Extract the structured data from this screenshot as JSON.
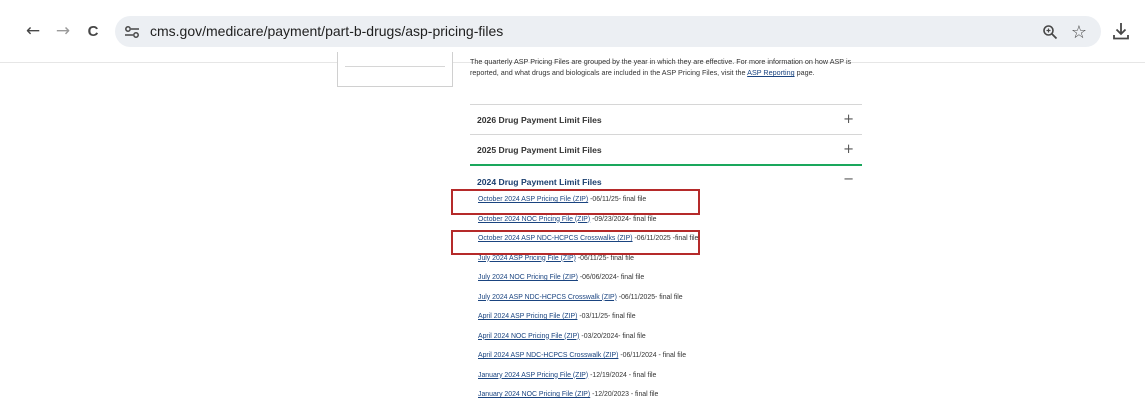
{
  "browser": {
    "url": "cms.gov/medicare/payment/part-b-drugs/asp-pricing-files",
    "back_icon": "←",
    "forward_icon": "→",
    "reload_icon": "C",
    "zoom_icon": "🔍",
    "star_icon": "☆"
  },
  "page": {
    "intro_text": "The quarterly ASP Pricing Files are grouped by the year in which they are effective.  For more information on how ASP is reported, and what drugs and biologicals are included in the ASP Pricing Files, visit the ",
    "intro_link": "ASP Reporting",
    "intro_suffix": " page.",
    "accordions": [
      {
        "title": "2026 Drug Payment Limit Files",
        "toggle": "+"
      },
      {
        "title": "2025 Drug Payment Limit Files",
        "toggle": "+"
      },
      {
        "title": "2024 Drug Payment Limit Files",
        "toggle": "−"
      }
    ],
    "files": [
      {
        "link": "October 2024 ASP Pricing File (ZIP)",
        "note": " -06/11/25- final file"
      },
      {
        "link": "October 2024 NOC Pricing File (ZIP)",
        "note": " -09/23/2024- final file"
      },
      {
        "link": "October 2024 ASP NDC-HCPCS Crosswalks (ZIP)",
        "note": " -06/11/2025 -final file"
      },
      {
        "link": "July 2024 ASP Pricing File (ZIP)",
        "note": " -06/11/25- final file"
      },
      {
        "link": "July 2024 NOC Pricing File (ZIP)",
        "note": " -06/06/2024- final file"
      },
      {
        "link": "July 2024 ASP NDC-HCPCS Crosswalk (ZIP)",
        "note": " -06/11/2025- final file"
      },
      {
        "link": "April 2024 ASP Pricing File (ZIP)",
        "note": "  -03/11/25- final file"
      },
      {
        "link": "April 2024 NOC Pricing File (ZIP)",
        "note": " -03/20/2024- final file"
      },
      {
        "link": "April 2024 ASP NDC-HCPCS Crosswalk (ZIP)",
        "note": " -06/11/2024 - final file"
      },
      {
        "link": "January 2024 ASP Pricing File (ZIP)",
        "note": " -12/19/2024 - final file"
      },
      {
        "link": "January 2024 NOC Pricing File (ZIP)",
        "note": " -12/20/2023 - final file"
      }
    ]
  },
  "colors": {
    "link": "#1a4480",
    "highlight": "#b52a2a",
    "open_accordion_border": "#1aa75c"
  }
}
